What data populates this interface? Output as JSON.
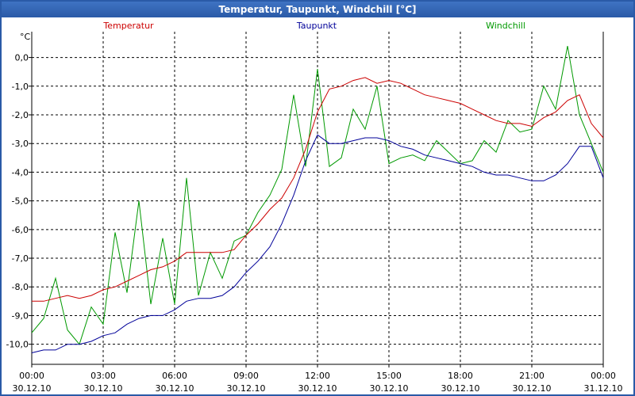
{
  "window": {
    "title": "Temperatur, Taupunkt, Windchill [°C]"
  },
  "chart_data": {
    "type": "line",
    "title": "Temperatur, Taupunkt, Windchill [°C]",
    "ylabel": "°C",
    "xlabel": "",
    "ylim": [
      -10.7,
      0.9
    ],
    "xlim": [
      0,
      24
    ],
    "grid": true,
    "legend": "top",
    "y_ticks": [
      "0,0",
      "-1,0",
      "-2,0",
      "-3,0",
      "-4,0",
      "-5,0",
      "-6,0",
      "-7,0",
      "-8,0",
      "-9,0",
      "-10,0"
    ],
    "x_tick_times": [
      "00:00",
      "03:00",
      "06:00",
      "09:00",
      "12:00",
      "15:00",
      "18:00",
      "21:00",
      "00:00"
    ],
    "x_tick_dates": [
      "30.12.10",
      "30.12.10",
      "30.12.10",
      "30.12.10",
      "30.12.10",
      "30.12.10",
      "30.12.10",
      "30.12.10",
      "31.12.10"
    ],
    "x_hours": [
      0,
      0.5,
      1,
      1.5,
      2,
      2.5,
      3,
      3.5,
      4,
      4.5,
      5,
      5.5,
      6,
      6.5,
      7,
      7.5,
      8,
      8.5,
      9,
      9.5,
      10,
      10.5,
      11,
      11.5,
      12,
      12.5,
      13,
      13.5,
      14,
      14.5,
      15,
      15.5,
      16,
      16.5,
      17,
      17.5,
      18,
      18.5,
      19,
      19.5,
      20,
      20.5,
      21,
      21.5,
      22,
      22.5,
      23,
      23.5,
      24
    ],
    "series": [
      {
        "name": "Temperatur",
        "color": "#cc0000",
        "values": [
          -8.5,
          -8.5,
          -8.4,
          -8.3,
          -8.4,
          -8.3,
          -8.1,
          -8.0,
          -7.8,
          -7.6,
          -7.4,
          -7.3,
          -7.1,
          -6.8,
          -6.8,
          -6.8,
          -6.8,
          -6.7,
          -6.2,
          -5.8,
          -5.3,
          -4.9,
          -4.2,
          -3.2,
          -1.9,
          -1.1,
          -1.0,
          -0.8,
          -0.7,
          -0.9,
          -0.8,
          -0.9,
          -1.1,
          -1.3,
          -1.4,
          -1.5,
          -1.6,
          -1.8,
          -2.0,
          -2.2,
          -2.3,
          -2.3,
          -2.4,
          -2.1,
          -1.9,
          -1.5,
          -1.3,
          -2.3,
          -2.8
        ]
      },
      {
        "name": "Taupunkt",
        "color": "#000099",
        "values": [
          -10.3,
          -10.2,
          -10.2,
          -10.0,
          -10.0,
          -9.9,
          -9.7,
          -9.6,
          -9.3,
          -9.1,
          -9.0,
          -9.0,
          -8.8,
          -8.5,
          -8.4,
          -8.4,
          -8.3,
          -8.0,
          -7.5,
          -7.1,
          -6.6,
          -5.8,
          -4.8,
          -3.6,
          -2.7,
          -3.0,
          -3.0,
          -2.9,
          -2.8,
          -2.8,
          -2.9,
          -3.1,
          -3.2,
          -3.4,
          -3.5,
          -3.6,
          -3.7,
          -3.8,
          -4.0,
          -4.1,
          -4.1,
          -4.2,
          -4.3,
          -4.3,
          -4.1,
          -3.7,
          -3.1,
          -3.1,
          -4.2
        ]
      },
      {
        "name": "Windchill",
        "color": "#009900",
        "values": [
          -9.6,
          -9.1,
          -7.7,
          -9.5,
          -10.0,
          -8.7,
          -9.3,
          -6.1,
          -8.2,
          -5.0,
          -8.6,
          -6.3,
          -8.6,
          -4.2,
          -8.3,
          -6.8,
          -7.7,
          -6.4,
          -6.2,
          -5.4,
          -4.8,
          -3.9,
          -1.3,
          -3.8,
          -0.4,
          -3.8,
          -3.5,
          -1.8,
          -2.5,
          -1.0,
          -3.7,
          -3.5,
          -3.4,
          -3.6,
          -2.9,
          -3.3,
          -3.7,
          -3.6,
          -2.9,
          -3.3,
          -2.2,
          -2.6,
          -2.5,
          -1.0,
          -1.8,
          0.4,
          -2.0,
          -3.0,
          -4.0
        ]
      }
    ]
  }
}
